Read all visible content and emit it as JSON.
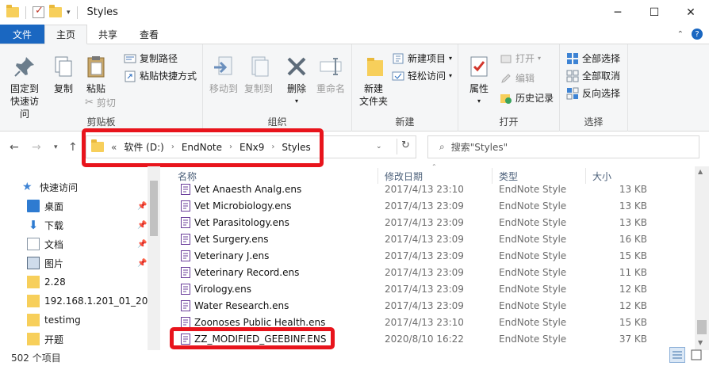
{
  "window": {
    "title": "Styles",
    "minimize": "─",
    "maximize": "☐",
    "close": "✕"
  },
  "tabs": [
    "文件",
    "主页",
    "共享",
    "查看"
  ],
  "ribbon": {
    "clipboard": {
      "label": "剪贴板",
      "pin": "固定到快速访问",
      "copy": "复制",
      "paste": "粘贴",
      "copy_path": "复制路径",
      "paste_shortcut": "粘贴快捷方式",
      "cut": "剪切"
    },
    "organize": {
      "label": "组织",
      "move_to": "移动到",
      "copy_to": "复制到",
      "delete": "删除",
      "rename": "重命名"
    },
    "new": {
      "label": "新建",
      "new_folder": "新建\n文件夹",
      "new_item": "新建项目",
      "easy_access": "轻松访问"
    },
    "open": {
      "label": "打开",
      "properties": "属性",
      "open": "打开",
      "edit": "编辑",
      "history": "历史记录"
    },
    "select": {
      "label": "选择",
      "select_all": "全部选择",
      "select_none": "全部取消",
      "invert": "反向选择"
    }
  },
  "address": {
    "crumbs": [
      "软件 (D:)",
      "EndNote",
      "ENx9",
      "Styles"
    ],
    "overflow": "«",
    "search_placeholder": "搜索\"Styles\""
  },
  "nav": {
    "items": [
      {
        "label": "快速访问",
        "icon": "star-icon"
      },
      {
        "label": "桌面",
        "icon": "desktop-icon"
      },
      {
        "label": "下载",
        "icon": "download-icon"
      },
      {
        "label": "文档",
        "icon": "document-icon"
      },
      {
        "label": "图片",
        "icon": "picture-icon"
      },
      {
        "label": "2.28",
        "icon": "folder-icon"
      },
      {
        "label": "192.168.1.201_01_2022",
        "icon": "folder-icon"
      },
      {
        "label": "testimg",
        "icon": "folder-icon"
      },
      {
        "label": "开题",
        "icon": "folder-icon"
      }
    ]
  },
  "columns": {
    "name": "名称",
    "date": "修改日期",
    "type": "类型",
    "size": "大小"
  },
  "files": [
    {
      "name": "Vet Anaesth Analg.ens",
      "date": "2017/4/13 23:10",
      "type": "EndNote Style",
      "size": "13 KB"
    },
    {
      "name": "Vet Microbiology.ens",
      "date": "2017/4/13 23:09",
      "type": "EndNote Style",
      "size": "13 KB"
    },
    {
      "name": "Vet Parasitology.ens",
      "date": "2017/4/13 23:09",
      "type": "EndNote Style",
      "size": "13 KB"
    },
    {
      "name": "Vet Surgery.ens",
      "date": "2017/4/13 23:09",
      "type": "EndNote Style",
      "size": "16 KB"
    },
    {
      "name": "Veterinary J.ens",
      "date": "2017/4/13 23:09",
      "type": "EndNote Style",
      "size": "15 KB"
    },
    {
      "name": "Veterinary Record.ens",
      "date": "2017/4/13 23:09",
      "type": "EndNote Style",
      "size": "11 KB"
    },
    {
      "name": "Virology.ens",
      "date": "2017/4/13 23:09",
      "type": "EndNote Style",
      "size": "12 KB"
    },
    {
      "name": "Water Research.ens",
      "date": "2017/4/13 23:09",
      "type": "EndNote Style",
      "size": "12 KB"
    },
    {
      "name": "Zoonoses Public Health.ens",
      "date": "2017/4/13 23:10",
      "type": "EndNote Style",
      "size": "15 KB"
    },
    {
      "name": "ZZ_MODIFIED_GEEBINF.ENS",
      "date": "2020/8/10 16:22",
      "type": "EndNote Style",
      "size": "37 KB"
    }
  ],
  "status": {
    "count": "502 个项目"
  },
  "colors": {
    "accent": "#1a67c1",
    "highlight": "#e8141c",
    "folder": "#f7cf5b"
  }
}
